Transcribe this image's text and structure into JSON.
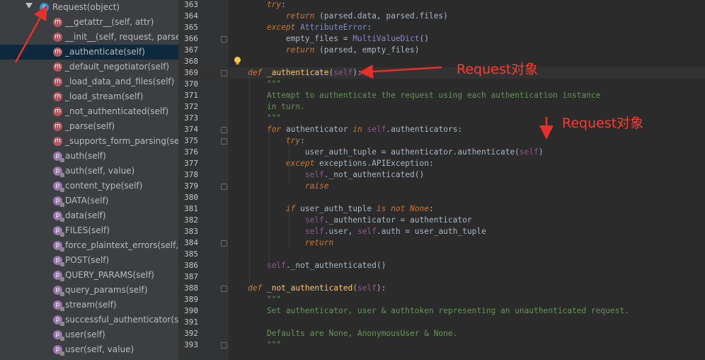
{
  "sidebar": {
    "root": {
      "label": "Request(object)",
      "icon": "class-icon",
      "badge": "c"
    },
    "items": [
      {
        "label": "__getattr__(self, attr)",
        "icon": "method-icon",
        "badge": "m",
        "selected": false
      },
      {
        "label": "__init__(self, request, parsers",
        "icon": "method-icon",
        "badge": "m",
        "selected": false
      },
      {
        "label": "_authenticate(self)",
        "icon": "method-icon",
        "badge": "m",
        "selected": true
      },
      {
        "label": "_default_negotiator(self)",
        "icon": "method-icon",
        "badge": "m",
        "selected": false
      },
      {
        "label": "_load_data_and_files(self)",
        "icon": "method-icon",
        "badge": "m",
        "selected": false
      },
      {
        "label": "_load_stream(self)",
        "icon": "method-icon",
        "badge": "m",
        "selected": false
      },
      {
        "label": "_not_authenticated(self)",
        "icon": "method-icon",
        "badge": "m",
        "selected": false
      },
      {
        "label": "_parse(self)",
        "icon": "method-icon",
        "badge": "m",
        "selected": false
      },
      {
        "label": "_supports_form_parsing(sel",
        "icon": "method-icon",
        "badge": "m",
        "selected": false
      },
      {
        "label": "auth(self)",
        "icon": "property-icon",
        "badge": "p",
        "selected": false
      },
      {
        "label": "auth(self, value)",
        "icon": "property-icon",
        "badge": "p",
        "selected": false
      },
      {
        "label": "content_type(self)",
        "icon": "property-icon",
        "badge": "p",
        "selected": false
      },
      {
        "label": "DATA(self)",
        "icon": "property-icon",
        "badge": "p",
        "selected": false
      },
      {
        "label": "data(self)",
        "icon": "property-icon",
        "badge": "p",
        "selected": false
      },
      {
        "label": "FILES(self)",
        "icon": "property-icon",
        "badge": "p",
        "selected": false
      },
      {
        "label": "force_plaintext_errors(self, v",
        "icon": "property-icon",
        "badge": "p",
        "selected": false
      },
      {
        "label": "POST(self)",
        "icon": "property-icon",
        "badge": "p",
        "selected": false
      },
      {
        "label": "QUERY_PARAMS(self)",
        "icon": "property-icon",
        "badge": "p",
        "selected": false
      },
      {
        "label": "query_params(self)",
        "icon": "property-icon",
        "badge": "p",
        "selected": false
      },
      {
        "label": "stream(self)",
        "icon": "property-icon",
        "badge": "p",
        "selected": false
      },
      {
        "label": "successful_authenticator(self",
        "icon": "property-icon",
        "badge": "p",
        "selected": false
      },
      {
        "label": "user(self)",
        "icon": "property-icon",
        "badge": "p",
        "selected": false
      },
      {
        "label": "user(self, value)",
        "icon": "property-icon",
        "badge": "p",
        "selected": false
      }
    ]
  },
  "editor": {
    "current_line": "369",
    "lines": [
      {
        "n": "363",
        "html": "        <span class=\"kw\">try</span>:"
      },
      {
        "n": "364",
        "html": "            <span class=\"kw\">return</span> (parsed.data, parsed.files)"
      },
      {
        "n": "365",
        "html": "        <span class=\"kw\">except</span> <span class=\"ann\">AttributeError</span>:"
      },
      {
        "n": "366",
        "html": "            empty_files = <span class=\"ann\">MultiValueDict</span>()"
      },
      {
        "n": "367",
        "html": "            <span class=\"kw\">return</span> (parsed, empty_files)"
      },
      {
        "n": "368",
        "html": ""
      },
      {
        "n": "369",
        "html": "    <span class=\"kw\">def</span> <span class=\"fn\">_authenticate</span>(<span class=\"self\">self</span>):"
      },
      {
        "n": "370",
        "html": "        <span class=\"doc\">\"\"\"</span>"
      },
      {
        "n": "371",
        "html": "        <span class=\"doc\">Attempt to authenticate the request using each authentication instance</span>"
      },
      {
        "n": "372",
        "html": "        <span class=\"doc\">in turn.</span>"
      },
      {
        "n": "373",
        "html": "        <span class=\"doc\">\"\"\"</span>"
      },
      {
        "n": "374",
        "html": "        <span class=\"kw\">for</span> authenticator <span class=\"kw\">in</span> <span class=\"self\">self</span>.authenticators:"
      },
      {
        "n": "375",
        "html": "            <span class=\"kw\">try</span>:"
      },
      {
        "n": "376",
        "html": "                user_auth_tuple = authenticator.authenticate(<span class=\"self\">self</span>)"
      },
      {
        "n": "377",
        "html": "            <span class=\"kw\">except</span> exceptions.APIException:"
      },
      {
        "n": "378",
        "html": "                <span class=\"self\">self</span>._not_authenticated()"
      },
      {
        "n": "379",
        "html": "                <span class=\"kw\">raise</span>"
      },
      {
        "n": "380",
        "html": ""
      },
      {
        "n": "381",
        "html": "            <span class=\"kw\">if</span> user_auth_tuple <span class=\"kw\">is not</span> <span class=\"kw\">None</span>:"
      },
      {
        "n": "382",
        "html": "                <span class=\"self\">self</span>._authenticator = authenticator"
      },
      {
        "n": "383",
        "html": "                <span class=\"self\">self</span>.user, <span class=\"self\">self</span>.auth = user_auth_tuple"
      },
      {
        "n": "384",
        "html": "                <span class=\"kw\">return</span>"
      },
      {
        "n": "385",
        "html": ""
      },
      {
        "n": "386",
        "html": "        <span class=\"self\">self</span>._not_authenticated()"
      },
      {
        "n": "387",
        "html": ""
      },
      {
        "n": "388",
        "html": "    <span class=\"kw\">def</span> <span class=\"fn\">_not_authenticated</span>(<span class=\"self\">self</span>):"
      },
      {
        "n": "389",
        "html": "        <span class=\"doc\">\"\"\"</span>"
      },
      {
        "n": "390",
        "html": "        <span class=\"doc\">Set authenticator, user &amp; authtoken representing an unauthenticated request.</span>"
      },
      {
        "n": "391",
        "html": ""
      },
      {
        "n": "392",
        "html": "        <span class=\"doc\">Defaults are None, AnonymousUser &amp; None.</span>"
      },
      {
        "n": "393",
        "html": "        <span class=\"doc\">\"\"\"</span>"
      }
    ]
  },
  "annotations": [
    {
      "text": "Request对象",
      "color": "#ff3b30"
    },
    {
      "text": "Request对象",
      "color": "#ff3b30"
    }
  ],
  "colors": {
    "sidebar_bg": "#3c3f41",
    "editor_bg": "#2b2b2b",
    "selection": "#0d293e",
    "annotation": "#ff3b30"
  }
}
